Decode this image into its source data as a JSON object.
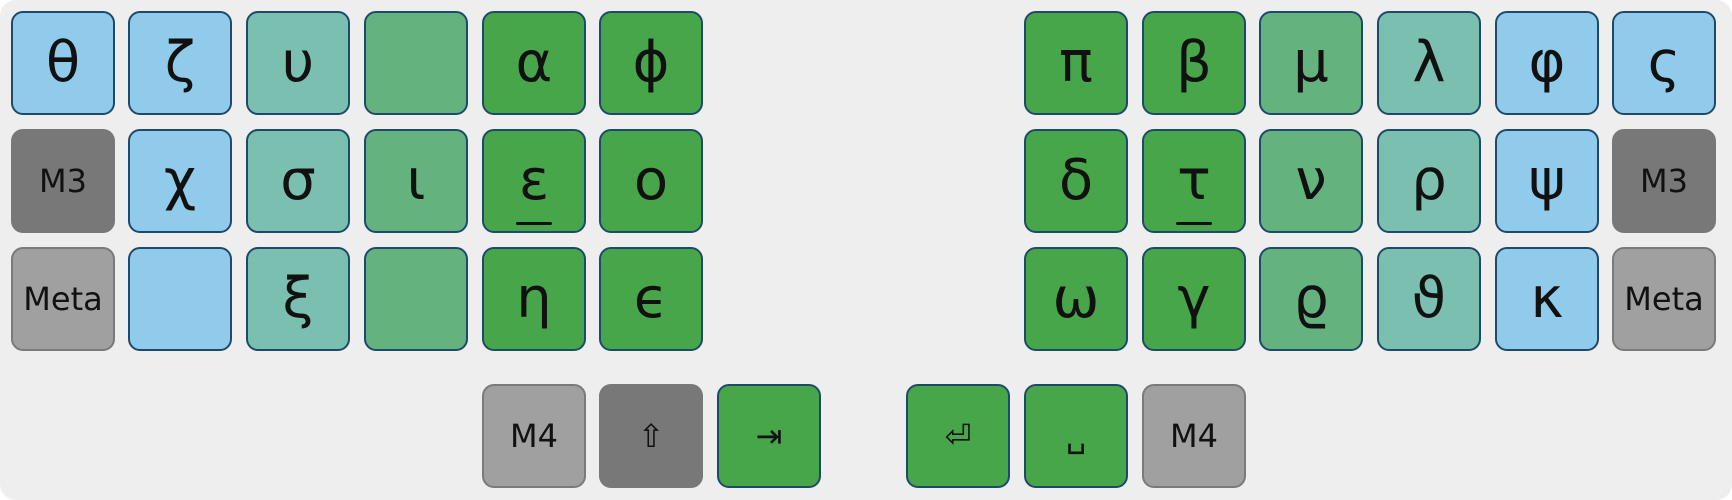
{
  "layout_name": "",
  "colors": {
    "background": "#eeeeee",
    "blue": "#91cbec",
    "teal": "#7bbfb0",
    "light_green": "#64b27e",
    "green": "#48a64a",
    "gray": "#a0a0a0",
    "dark_gray": "#787878",
    "key_border": "#1e4a6a"
  },
  "keys": {
    "l_r0_c0": {
      "label": "θ",
      "color": "blue"
    },
    "l_r0_c1": {
      "label": "ζ",
      "color": "blue"
    },
    "l_r0_c2": {
      "label": "υ",
      "color": "teal"
    },
    "l_r0_c3": {
      "label": "",
      "color": "light_green"
    },
    "l_r0_c4": {
      "label": "α",
      "color": "green"
    },
    "l_r0_c5": {
      "label": "ϕ",
      "color": "green"
    },
    "l_r1_c0": {
      "label": "M3",
      "color": "dark_gray"
    },
    "l_r1_c1": {
      "label": "χ",
      "color": "blue"
    },
    "l_r1_c2": {
      "label": "σ",
      "color": "teal"
    },
    "l_r1_c3": {
      "label": "ι",
      "color": "light_green"
    },
    "l_r1_c4": {
      "label": "ε",
      "color": "green",
      "homing": true
    },
    "l_r1_c5": {
      "label": "ο",
      "color": "green"
    },
    "l_r2_c0": {
      "label": "Meta",
      "color": "gray"
    },
    "l_r2_c1": {
      "label": "",
      "color": "blue"
    },
    "l_r2_c2": {
      "label": "ξ",
      "color": "teal"
    },
    "l_r2_c3": {
      "label": "",
      "color": "light_green"
    },
    "l_r2_c4": {
      "label": "η",
      "color": "green"
    },
    "l_r2_c5": {
      "label": "ϵ",
      "color": "green"
    },
    "r_r0_c0": {
      "label": "π",
      "color": "green"
    },
    "r_r0_c1": {
      "label": "β",
      "color": "green"
    },
    "r_r0_c2": {
      "label": "μ",
      "color": "light_green"
    },
    "r_r0_c3": {
      "label": "λ",
      "color": "teal"
    },
    "r_r0_c4": {
      "label": "φ",
      "color": "blue"
    },
    "r_r0_c5": {
      "label": "ς",
      "color": "blue"
    },
    "r_r1_c0": {
      "label": "δ",
      "color": "green"
    },
    "r_r1_c1": {
      "label": "τ",
      "color": "green",
      "homing": true
    },
    "r_r1_c2": {
      "label": "ν",
      "color": "light_green"
    },
    "r_r1_c3": {
      "label": "ρ",
      "color": "teal"
    },
    "r_r1_c4": {
      "label": "ψ",
      "color": "blue"
    },
    "r_r1_c5": {
      "label": "M3",
      "color": "dark_gray"
    },
    "r_r2_c0": {
      "label": "ω",
      "color": "green"
    },
    "r_r2_c1": {
      "label": "γ",
      "color": "green"
    },
    "r_r2_c2": {
      "label": "ϱ",
      "color": "light_green"
    },
    "r_r2_c3": {
      "label": "ϑ",
      "color": "teal"
    },
    "r_r2_c4": {
      "label": "κ",
      "color": "blue"
    },
    "r_r2_c5": {
      "label": "Meta",
      "color": "gray"
    },
    "thumb_l0": {
      "label": "M4",
      "color": "gray"
    },
    "thumb_l1": {
      "label": "⇧",
      "color": "dark_gray"
    },
    "thumb_l2": {
      "label": "⇥",
      "color": "green"
    },
    "thumb_r0": {
      "label": "⏎",
      "color": "green"
    },
    "thumb_r1": {
      "label": "␣",
      "color": "green"
    },
    "thumb_r2": {
      "label": "M4",
      "color": "gray"
    }
  }
}
